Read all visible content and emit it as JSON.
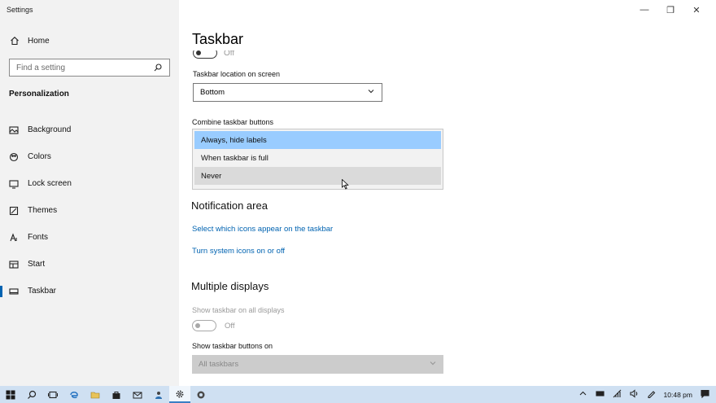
{
  "window": {
    "title": "Settings",
    "controls": {
      "minimize": "—",
      "restore": "❐",
      "close": "✕"
    }
  },
  "sidebar": {
    "home_label": "Home",
    "search_placeholder": "Find a setting",
    "section": "Personalization",
    "items": [
      {
        "label": "Background",
        "icon": "picture-icon"
      },
      {
        "label": "Colors",
        "icon": "palette-icon"
      },
      {
        "label": "Lock screen",
        "icon": "lock-screen-icon"
      },
      {
        "label": "Themes",
        "icon": "brush-icon"
      },
      {
        "label": "Fonts",
        "icon": "font-icon"
      },
      {
        "label": "Start",
        "icon": "start-icon"
      },
      {
        "label": "Taskbar",
        "icon": "taskbar-icon",
        "active": true
      }
    ]
  },
  "main": {
    "title": "Taskbar",
    "top_toggle_state": "Off",
    "location_label": "Taskbar location on screen",
    "location_value": "Bottom",
    "combine_label": "Combine taskbar buttons",
    "combine_options": [
      "Always, hide labels",
      "When taskbar is full",
      "Never"
    ],
    "combine_selected": "Always, hide labels",
    "notification_heading": "Notification area",
    "link_icons": "Select which icons appear on the taskbar",
    "link_system_icons": "Turn system icons on or off",
    "multiple_heading": "Multiple displays",
    "show_all_label": "Show taskbar on all displays",
    "show_all_state": "Off",
    "show_buttons_label": "Show taskbar buttons on",
    "show_buttons_value": "All taskbars"
  },
  "taskbar": {
    "clock": "10:48 pm",
    "accent": "#cfe0f2"
  }
}
